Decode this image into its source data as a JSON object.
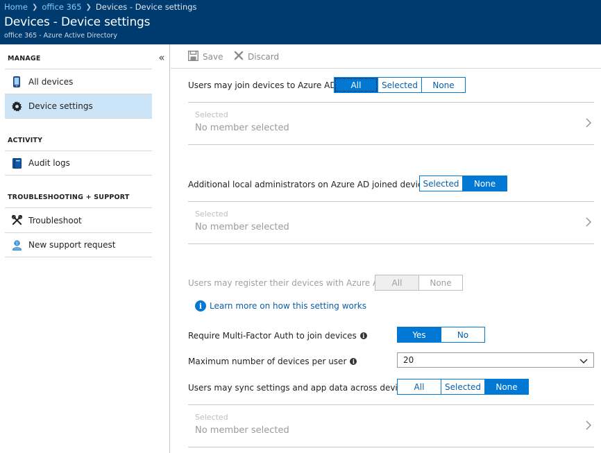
{
  "header": {
    "breadcrumb": [
      "Home",
      "office 365",
      "Devices - Device settings"
    ],
    "title": "Devices - Device settings",
    "subtitle": "office 365 - Azure Active Directory"
  },
  "sidebar": {
    "collapse_glyph": "«",
    "sections": [
      {
        "label": "MANAGE",
        "items": [
          {
            "label": "All devices",
            "icon": "phone-icon"
          },
          {
            "label": "Device settings",
            "icon": "gear-icon",
            "active": true
          }
        ]
      },
      {
        "label": "ACTIVITY",
        "items": [
          {
            "label": "Audit logs",
            "icon": "book-icon"
          }
        ]
      },
      {
        "label": "TROUBLESHOOTING + SUPPORT",
        "items": [
          {
            "label": "Troubleshoot",
            "icon": "wrench-icon"
          },
          {
            "label": "New support request",
            "icon": "support-person-icon"
          }
        ]
      }
    ]
  },
  "toolbar": {
    "save_label": "Save",
    "discard_label": "Discard"
  },
  "settings": {
    "join": {
      "label": "Users may join devices to Azure AD",
      "options": [
        "All",
        "Selected",
        "None"
      ],
      "selected": "All"
    },
    "join_members": {
      "small": "Selected",
      "main": "No member selected"
    },
    "admins": {
      "label": "Additional local administrators on Azure AD joined devices",
      "options": [
        "Selected",
        "None"
      ],
      "selected": "None"
    },
    "admins_members": {
      "small": "Selected",
      "main": "No member selected"
    },
    "register": {
      "label": "Users may register their devices with Azure AD",
      "options": [
        "All",
        "None"
      ],
      "selected": "All",
      "disabled": true
    },
    "learn_more": "Learn more on how this setting works",
    "mfa": {
      "label": "Require Multi-Factor Auth to join devices",
      "options": [
        "Yes",
        "No"
      ],
      "selected": "Yes"
    },
    "max_devices": {
      "label": "Maximum number of devices per user",
      "value": "20"
    },
    "sync": {
      "label": "Users may sync settings and app data across devices",
      "options": [
        "All",
        "Selected",
        "None"
      ],
      "selected": "None"
    },
    "sync_members": {
      "small": "Selected",
      "main": "No member selected"
    }
  },
  "colors": {
    "header_bg": "#003b6f",
    "accent": "#0078d4",
    "active_nav": "#cce4f7"
  }
}
